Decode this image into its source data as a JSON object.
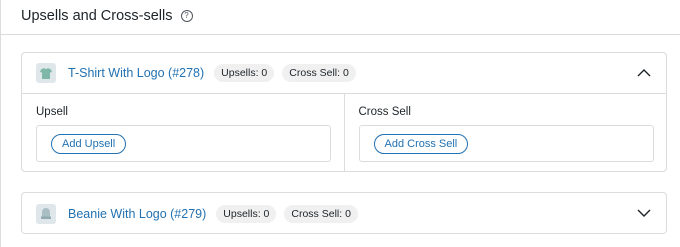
{
  "section": {
    "title": "Upsells and Cross-sells",
    "help_glyph": "?"
  },
  "products": [
    {
      "name": "T-Shirt With Logo (#278)",
      "upsells_pill": "Upsells: 0",
      "cross_sell_pill": "Cross Sell: 0",
      "icon": "tshirt-icon",
      "expanded": true,
      "chevron": "chevron-up-icon",
      "upsell": {
        "label": "Upsell",
        "button": "Add Upsell"
      },
      "cross_sell": {
        "label": "Cross Sell",
        "button": "Add Cross Sell"
      }
    },
    {
      "name": "Beanie With Logo (#279)",
      "upsells_pill": "Upsells: 0",
      "cross_sell_pill": "Cross Sell: 0",
      "icon": "beanie-icon",
      "expanded": false,
      "chevron": "chevron-down-icon"
    }
  ],
  "colors": {
    "link": "#2271b1",
    "border": "#dcdcde",
    "pill_bg": "#f0f0f1"
  }
}
